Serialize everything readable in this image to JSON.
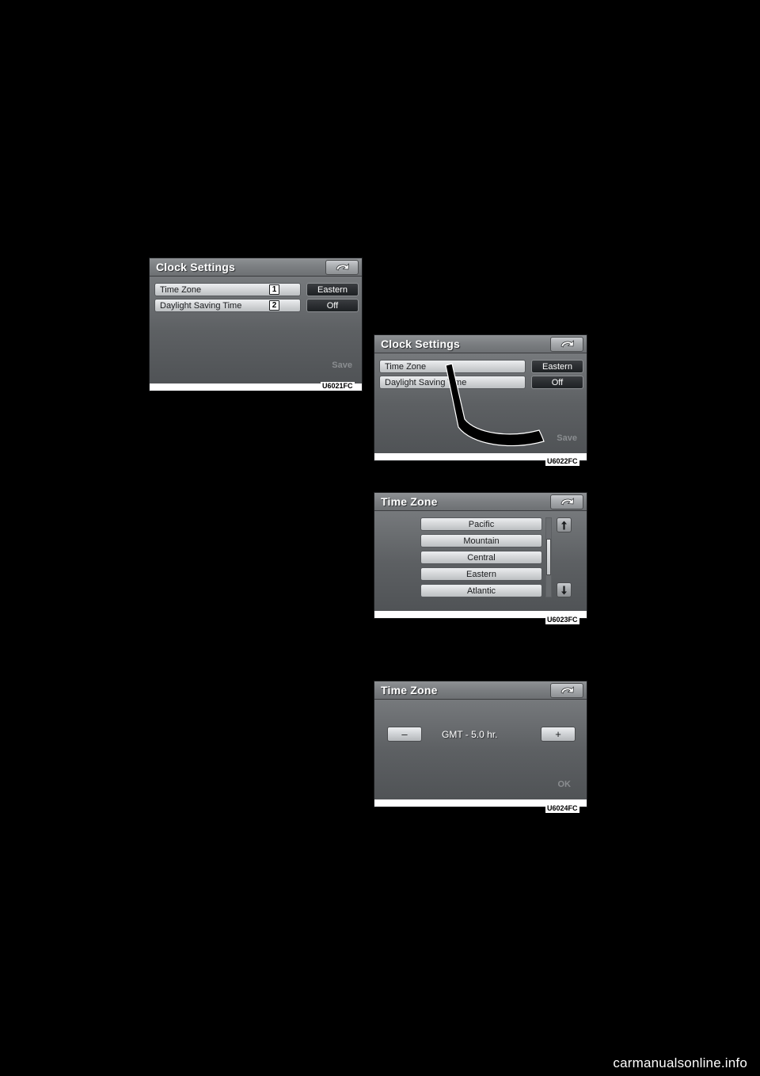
{
  "page": {
    "background_color": "#000000",
    "footer_brand": "carmanualsonline.info"
  },
  "screens": [
    {
      "id": "clock-settings-1",
      "title": "Clock Settings",
      "code": "U6021FC",
      "rows": [
        {
          "label": "Time Zone",
          "callout": "1",
          "value": "Eastern"
        },
        {
          "label": "Daylight Saving Time",
          "callout": "2",
          "value": "Off"
        }
      ],
      "save_label": "Save",
      "back_icon": "back-arrow-icon"
    },
    {
      "id": "clock-settings-2",
      "title": "Clock Settings",
      "code": "U6022FC",
      "rows": [
        {
          "label": "Time Zone",
          "value": "Eastern"
        },
        {
          "label": "Daylight Saving Time",
          "value": "Off"
        }
      ],
      "save_label": "Save",
      "back_icon": "back-arrow-icon"
    },
    {
      "id": "time-zone-list",
      "title": "Time Zone",
      "code": "U6023FC",
      "items": [
        "Pacific",
        "Mountain",
        "Central",
        "Eastern",
        "Atlantic"
      ],
      "scroll_up_icon": "scroll-up-arrow-icon",
      "scroll_down_icon": "scroll-down-arrow-icon",
      "back_icon": "back-arrow-icon"
    },
    {
      "id": "time-zone-gmt",
      "title": "Time Zone",
      "code": "U6024FC",
      "minus_label": "–",
      "plus_label": "+",
      "gmt_text": "GMT    -   5.0 hr.",
      "ok_label": "OK",
      "back_icon": "back-arrow-icon"
    }
  ]
}
